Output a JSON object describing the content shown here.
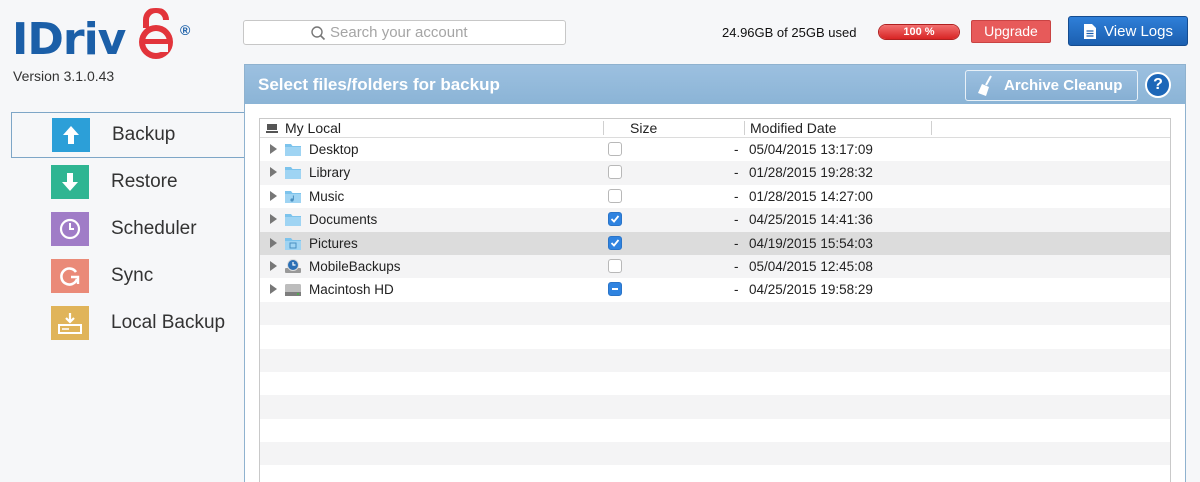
{
  "app": {
    "version": "Version 3.1.0.43"
  },
  "search": {
    "placeholder": "Search your account"
  },
  "usage": {
    "text": "24.96GB of 25GB used",
    "percent_label": "100 %",
    "percent": 100
  },
  "toolbar": {
    "upgrade_label": "Upgrade",
    "view_logs_label": "View Logs"
  },
  "sidebar": {
    "items": [
      {
        "label": "Backup",
        "icon": "upload-arrow-icon",
        "color": "#2c9fd8",
        "active": true
      },
      {
        "label": "Restore",
        "icon": "download-arrow-icon",
        "color": "#2fb592"
      },
      {
        "label": "Scheduler",
        "icon": "clock-icon",
        "color": "#a07cc7"
      },
      {
        "label": "Sync",
        "icon": "sync-icon",
        "color": "#ea8a78"
      },
      {
        "label": "Local Backup",
        "icon": "local-drive-icon",
        "color": "#e0b45a"
      }
    ]
  },
  "panel": {
    "title": "Select files/folders for backup",
    "archive_label": "Archive Cleanup",
    "help_label": "?"
  },
  "table": {
    "columns": [
      "My Local",
      "Size",
      "Modified Date"
    ],
    "rows": [
      {
        "name": "Desktop",
        "icon": "folder-icon",
        "checked": "none",
        "size": "-",
        "date": "05/04/2015 13:17:09"
      },
      {
        "name": "Library",
        "icon": "folder-icon",
        "checked": "none",
        "size": "-",
        "date": "01/28/2015 19:28:32"
      },
      {
        "name": "Music",
        "icon": "music-folder-icon",
        "checked": "none",
        "size": "-",
        "date": "01/28/2015 14:27:00"
      },
      {
        "name": "Documents",
        "icon": "folder-icon",
        "checked": "checked",
        "size": "-",
        "date": "04/25/2015 14:41:36"
      },
      {
        "name": "Pictures",
        "icon": "pictures-folder-icon",
        "checked": "checked",
        "size": "-",
        "date": "04/19/2015 15:54:03",
        "selected": true
      },
      {
        "name": "MobileBackups",
        "icon": "time-machine-drive-icon",
        "checked": "none",
        "size": "-",
        "date": "05/04/2015 12:45:08"
      },
      {
        "name": "Macintosh HD",
        "icon": "hard-drive-icon",
        "checked": "partial",
        "size": "-",
        "date": "04/25/2015 19:58:29"
      }
    ]
  }
}
